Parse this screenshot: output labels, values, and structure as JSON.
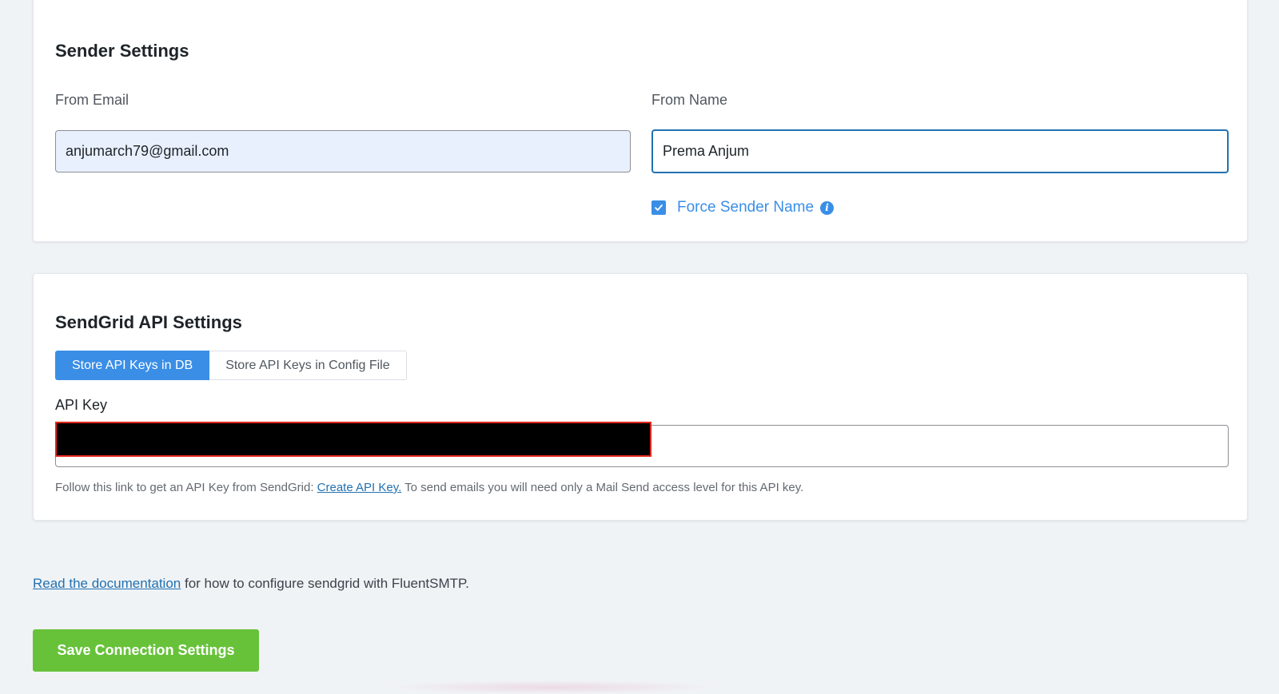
{
  "sender_settings": {
    "title": "Sender Settings",
    "from_email": {
      "label": "From Email",
      "value": "anjumarch79@gmail.com"
    },
    "from_name": {
      "label": "From Name",
      "value": "Prema Anjum"
    },
    "force_sender_name": {
      "label": "Force Sender Name",
      "checked": true
    }
  },
  "sendgrid_settings": {
    "title": "SendGrid API Settings",
    "storage_options": [
      {
        "label": "Store API Keys in DB",
        "active": true
      },
      {
        "label": "Store API Keys in Config File",
        "active": false
      }
    ],
    "api_key": {
      "label": "API Key"
    },
    "help": {
      "prefix": "Follow this link to get an API Key from SendGrid:",
      "link_text": "Create API Key.",
      "suffix": "To send emails you will need only a Mail Send access level for this API key."
    }
  },
  "footer": {
    "doc_link_text": "Read the documentation",
    "doc_suffix": "for how to configure sendgrid with FluentSMTP.",
    "save_label": "Save Connection Settings"
  },
  "colors": {
    "primary_blue": "#3a8ee6",
    "link_blue": "#2271b1",
    "save_green": "#67c23a",
    "autofill_bg": "#e8f0fe",
    "redaction_border": "#e3261c"
  },
  "icons": {
    "checkbox": "check-icon",
    "info": "info-icon"
  }
}
